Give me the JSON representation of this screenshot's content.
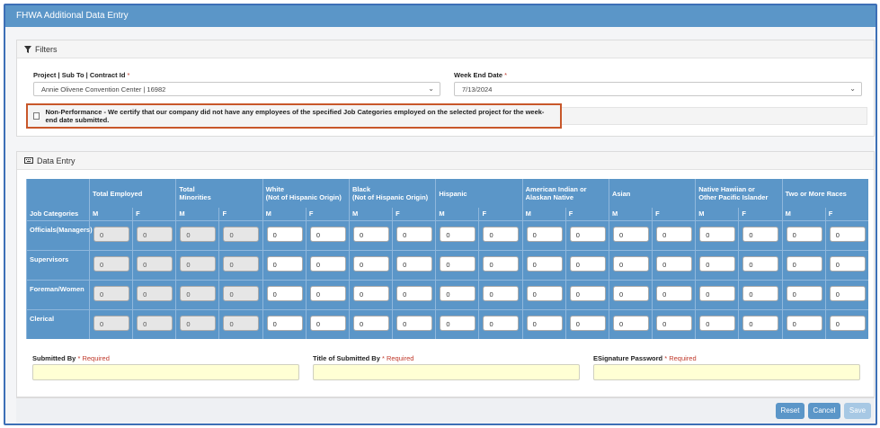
{
  "window": {
    "title": "FHWA Additional Data Entry"
  },
  "filters": {
    "heading": "Filters",
    "project_label": "Project | Sub To | Contract Id",
    "project_value": "Annie Olivene Convention Center | 16982",
    "week_label": "Week End Date",
    "week_value": "7/13/2024",
    "required_mark": "*",
    "nonperformance_text": "Non-Performance - We certify that our company did not have any employees of the specified Job Categories employed on the selected project for the week-end date submitted.",
    "nonperformance_checked": false
  },
  "data_entry": {
    "heading": "Data Entry",
    "job_categories_label": "Job Categories",
    "groups": [
      {
        "line1": "Total Employed",
        "line2": ""
      },
      {
        "line1": "Total",
        "line2": "Minorities"
      },
      {
        "line1": "White",
        "line2": "(Not of Hispanic Origin)"
      },
      {
        "line1": "Black",
        "line2": "(Not of Hispanic Origin)"
      },
      {
        "line1": "Hispanic",
        "line2": ""
      },
      {
        "line1": "American Indian or",
        "line2": "Alaskan Native"
      },
      {
        "line1": "Asian",
        "line2": ""
      },
      {
        "line1": "Native Hawiian or",
        "line2": "Other Pacific Islander"
      },
      {
        "line1": "Two or More Races",
        "line2": ""
      }
    ],
    "m_label": "M",
    "f_label": "F",
    "rows": [
      {
        "category": "Officials(Managers)",
        "values": [
          "0",
          "0",
          "0",
          "0",
          "0",
          "0",
          "0",
          "0",
          "0",
          "0",
          "0",
          "0",
          "0",
          "0",
          "0",
          "0",
          "0",
          "0"
        ]
      },
      {
        "category": "Supervisors",
        "values": [
          "0",
          "0",
          "0",
          "0",
          "0",
          "0",
          "0",
          "0",
          "0",
          "0",
          "0",
          "0",
          "0",
          "0",
          "0",
          "0",
          "0",
          "0"
        ]
      },
      {
        "category": "Foreman/Women",
        "values": [
          "0",
          "0",
          "0",
          "0",
          "0",
          "0",
          "0",
          "0",
          "0",
          "0",
          "0",
          "0",
          "0",
          "0",
          "0",
          "0",
          "0",
          "0"
        ]
      },
      {
        "category": "Clerical",
        "values": [
          "0",
          "0",
          "0",
          "0",
          "0",
          "0",
          "0",
          "0",
          "0",
          "0",
          "0",
          "0",
          "0",
          "0",
          "0",
          "0",
          "0",
          "0"
        ]
      }
    ]
  },
  "submission": {
    "submitted_by_label": "Submitted By",
    "title_label": "Title of Submitted By",
    "esig_label": "ESignature Password",
    "required_text": "* Required",
    "submitted_by_value": "",
    "title_value": "",
    "esig_value": ""
  },
  "buttons": {
    "reset": "Reset",
    "cancel": "Cancel",
    "save": "Save"
  },
  "colors": {
    "header_blue": "#5b96c8",
    "highlight_border": "#c8572a",
    "required_red": "#c0392b",
    "input_yellow": "#ffffd4"
  }
}
